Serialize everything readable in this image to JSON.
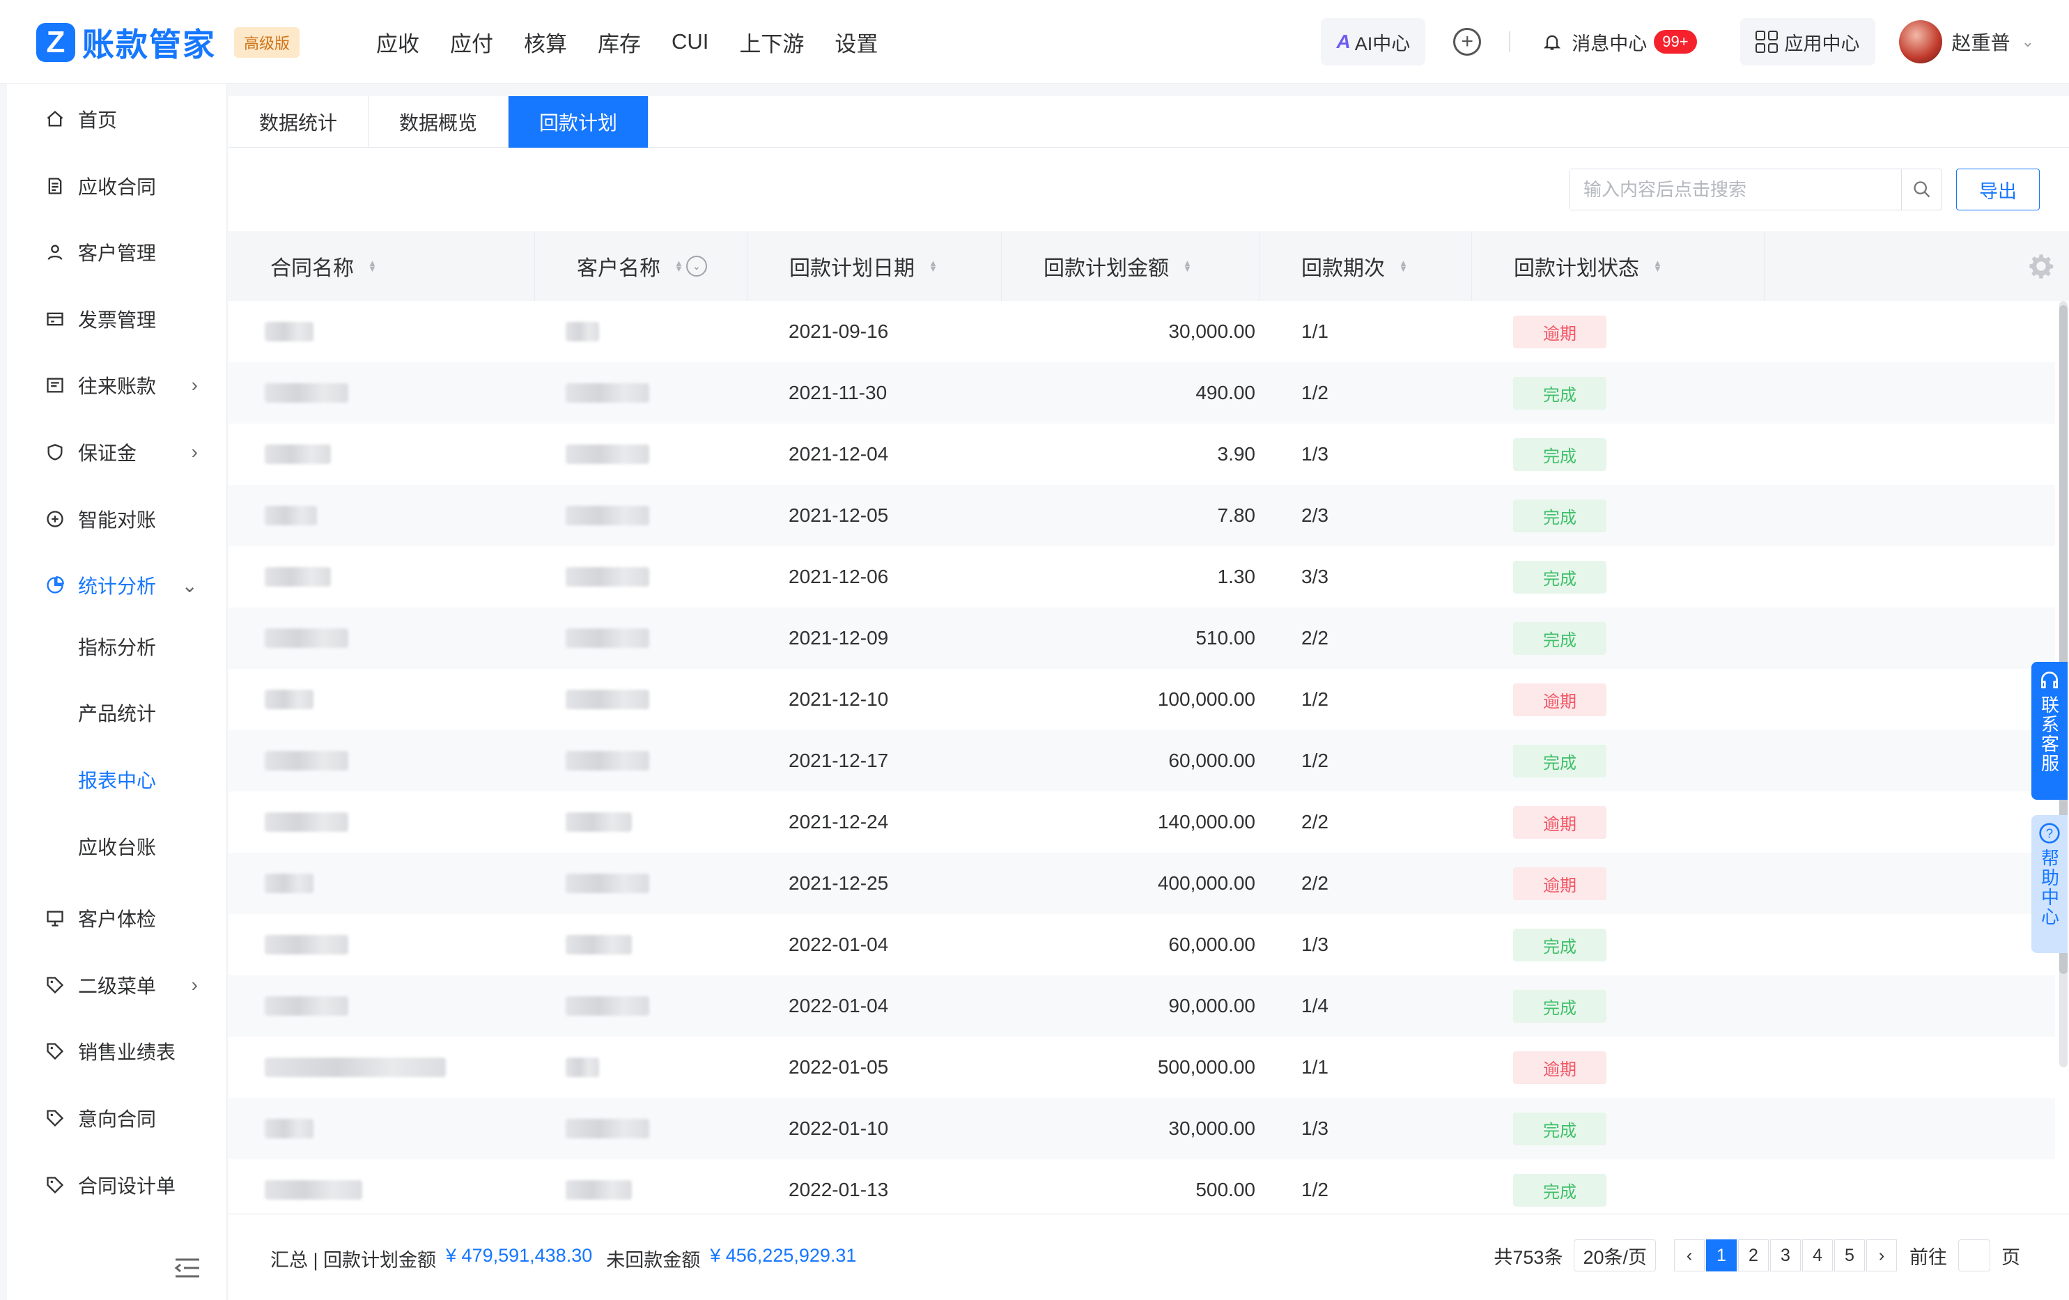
{
  "app": {
    "logo_mark": "Z",
    "name": "账款管家",
    "edition": "高级版"
  },
  "topnav": [
    "应收",
    "应付",
    "核算",
    "库存",
    "CUI",
    "上下游",
    "设置"
  ],
  "topright": {
    "ai": "AI中心",
    "messages": "消息中心",
    "message_count": "99+",
    "apps": "应用中心",
    "user": "赵重普"
  },
  "sidebar": {
    "items": [
      {
        "label": "首页",
        "icon": "home-icon"
      },
      {
        "label": "应收合同",
        "icon": "document-icon"
      },
      {
        "label": "客户管理",
        "icon": "user-icon"
      },
      {
        "label": "发票管理",
        "icon": "invoice-icon"
      },
      {
        "label": "往来账款",
        "icon": "ledger-icon",
        "arrow": "›"
      },
      {
        "label": "保证金",
        "icon": "shield-icon",
        "arrow": "›"
      },
      {
        "label": "智能对账",
        "icon": "reconcile-icon"
      },
      {
        "label": "统计分析",
        "icon": "pie-chart-icon",
        "arrow": "⌄"
      }
    ],
    "sub_items": [
      "指标分析",
      "产品统计",
      "报表中心",
      "应收台账"
    ],
    "items2": [
      {
        "label": "客户体检",
        "icon": "monitor-icon"
      },
      {
        "label": "二级菜单",
        "icon": "tag-icon",
        "arrow": "›"
      },
      {
        "label": "销售业绩表",
        "icon": "tag-icon"
      },
      {
        "label": "意向合同",
        "icon": "tag-icon"
      },
      {
        "label": "合同设计单",
        "icon": "tag-icon"
      }
    ]
  },
  "tabs": [
    "数据统计",
    "数据概览",
    "回款计划"
  ],
  "search": {
    "placeholder": "输入内容后点击搜索"
  },
  "export_label": "导出",
  "columns": [
    "合同名称",
    "客户名称",
    "回款计划日期",
    "回款计划金额",
    "回款期次",
    "回款计划状态"
  ],
  "status_colors": {
    "逾期": "#f25461",
    "完成": "#3fbf6a"
  },
  "rows": [
    {
      "date": "2021-09-16",
      "amount": "30,000.00",
      "period": "1/1",
      "status": "逾期"
    },
    {
      "date": "2021-11-30",
      "amount": "490.00",
      "period": "1/2",
      "status": "完成"
    },
    {
      "date": "2021-12-04",
      "amount": "3.90",
      "period": "1/3",
      "status": "完成"
    },
    {
      "date": "2021-12-05",
      "amount": "7.80",
      "period": "2/3",
      "status": "完成"
    },
    {
      "date": "2021-12-06",
      "amount": "1.30",
      "period": "3/3",
      "status": "完成"
    },
    {
      "date": "2021-12-09",
      "amount": "510.00",
      "period": "2/2",
      "status": "完成"
    },
    {
      "date": "2021-12-10",
      "amount": "100,000.00",
      "period": "1/2",
      "status": "逾期"
    },
    {
      "date": "2021-12-17",
      "amount": "60,000.00",
      "period": "1/2",
      "status": "完成"
    },
    {
      "date": "2021-12-24",
      "amount": "140,000.00",
      "period": "2/2",
      "status": "逾期"
    },
    {
      "date": "2021-12-25",
      "amount": "400,000.00",
      "period": "2/2",
      "status": "逾期"
    },
    {
      "date": "2022-01-04",
      "amount": "60,000.00",
      "period": "1/3",
      "status": "完成"
    },
    {
      "date": "2022-01-04",
      "amount": "90,000.00",
      "period": "1/4",
      "status": "完成"
    },
    {
      "date": "2022-01-05",
      "amount": "500,000.00",
      "period": "1/1",
      "status": "逾期"
    },
    {
      "date": "2022-01-10",
      "amount": "30,000.00",
      "period": "1/3",
      "status": "完成"
    },
    {
      "date": "2022-01-13",
      "amount": "500.00",
      "period": "1/2",
      "status": "完成"
    }
  ],
  "footer": {
    "summary_label": "汇总 | 回款计划金额",
    "plan_amount": "¥ 479,591,438.30",
    "unpaid_label": "未回款金额",
    "unpaid_amount": "¥ 456,225,929.31",
    "total": "共753条",
    "page_size": "20条/页",
    "pages": [
      "1",
      "2",
      "3",
      "4",
      "5"
    ],
    "prev": "‹",
    "next": "›",
    "goto_label": "前往",
    "page_suffix": "页"
  },
  "float": {
    "cs": "联系客服",
    "help": "帮助中心"
  }
}
